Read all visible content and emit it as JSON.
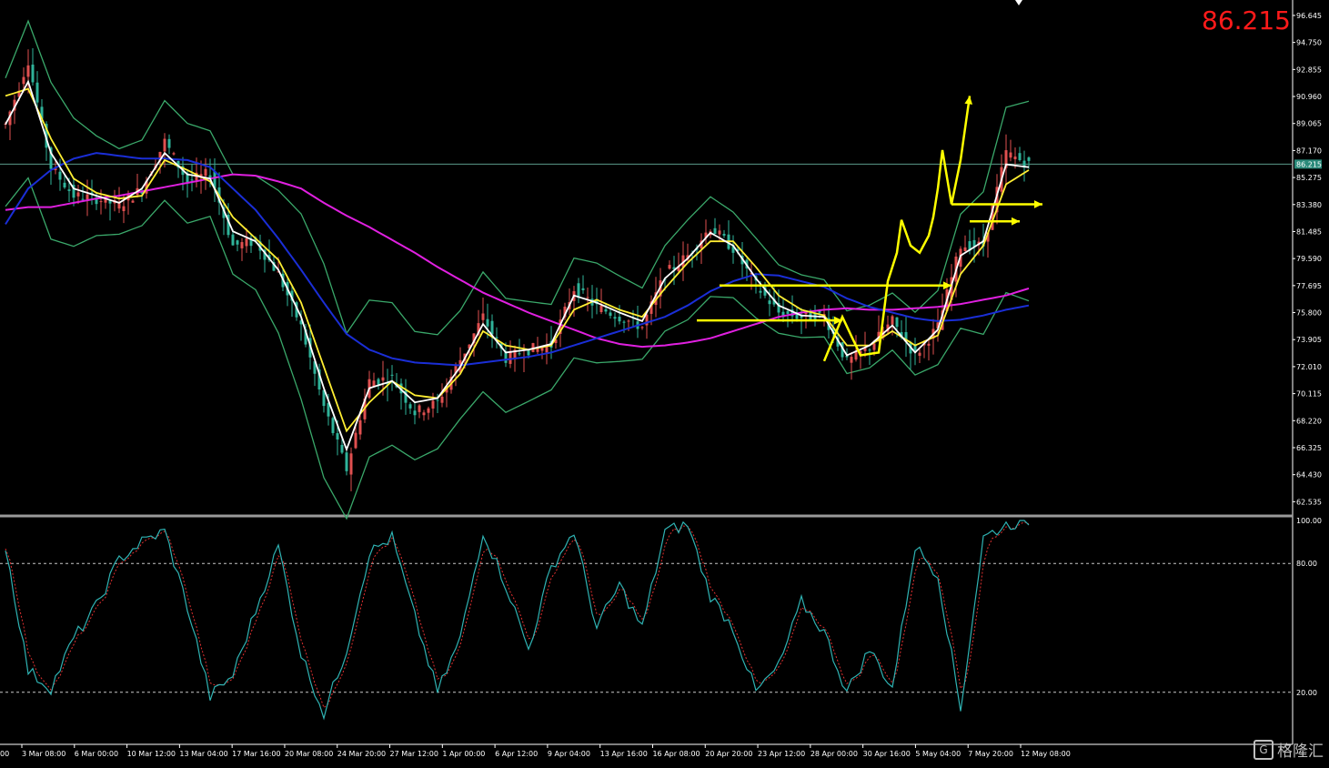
{
  "price_label": "86.215",
  "price_badge": "86.215",
  "watermark": {
    "text": "格隆汇",
    "logo": "G"
  },
  "colors": {
    "background": "#000000",
    "up_candle": "#e05050",
    "down_candle": "#2fb39a",
    "white_ma": "#ffffff",
    "yellow_ma": "#ffee33",
    "blue_ma": "#1a2ed6",
    "magenta_ma": "#e020e0",
    "bollinger": "#3aa86a",
    "annotation": "#ffff00",
    "stoch_main": "#2fb3b3",
    "stoch_signal": "#e03030",
    "price_text": "#ff1a1a",
    "axis_text": "#ffffff"
  },
  "chart_data": [
    {
      "type": "candlestick",
      "title": "",
      "ylim": [
        61.6,
        97.6
      ],
      "current_price": 86.215,
      "y_ticks": [
        "96.645",
        "94.750",
        "92.855",
        "90.960",
        "89.065",
        "87.170",
        "85.275",
        "83.380",
        "81.485",
        "79.590",
        "77.695",
        "75.800",
        "73.905",
        "72.010",
        "70.115",
        "68.220",
        "66.325",
        "64.430",
        "62.535"
      ],
      "x_ticks": [
        "3 Mar 08:00",
        "6 Mar 00:00",
        "10 Mar 12:00",
        "13 Mar 04:00",
        "17 Mar 16:00",
        "20 Mar 08:00",
        "24 Mar 20:00",
        "27 Mar 12:00",
        "1 Apr 00:00",
        "6 Apr 12:00",
        "9 Apr 04:00",
        "13 Apr 16:00",
        "16 Apr 08:00",
        "20 Apr 20:00",
        "23 Apr 12:00",
        "28 Apr 00:00",
        "30 Apr 16:00",
        "5 May 04:00",
        "7 May 20:00",
        "12 May 08:00"
      ],
      "x_edge_label": "00",
      "anchors": {
        "x": [
          0,
          5,
          10,
          15,
          20,
          25,
          30,
          35,
          40,
          45,
          50,
          55,
          60,
          65,
          70,
          75,
          80,
          85,
          90,
          95,
          100,
          105,
          110,
          115,
          120,
          125,
          130,
          135,
          140,
          145,
          150,
          155,
          160,
          165,
          170,
          175,
          180,
          185,
          190,
          195,
          200,
          205,
          210,
          215,
          220,
          225
        ],
        "close": [
          89.0,
          93.5,
          86.0,
          84.0,
          83.8,
          83.3,
          84.5,
          87.8,
          85.0,
          85.6,
          80.5,
          80.8,
          78.5,
          74.8,
          69.2,
          64.8,
          71.0,
          71.2,
          68.8,
          69.5,
          72.5,
          75.5,
          72.6,
          73.2,
          73.5,
          77.5,
          76.2,
          75.5,
          74.8,
          78.5,
          79.8,
          81.8,
          80.3,
          77.7,
          75.8,
          75.5,
          75.6,
          72.3,
          73.4,
          75.2,
          72.8,
          74.8,
          80.5,
          80.5,
          87.0,
          86.2
        ],
        "ma_white": [
          89.0,
          92.0,
          87.0,
          84.5,
          84.0,
          83.5,
          84.5,
          87.0,
          85.5,
          85.2,
          81.5,
          80.8,
          78.8,
          75.5,
          70.5,
          66.2,
          70.5,
          71.0,
          69.5,
          69.8,
          72.0,
          75.0,
          73.0,
          73.2,
          73.6,
          77.0,
          76.5,
          75.8,
          75.2,
          78.2,
          79.6,
          81.4,
          80.5,
          78.2,
          76.3,
          75.6,
          75.5,
          72.8,
          73.5,
          74.9,
          73.0,
          74.6,
          79.8,
          80.8,
          86.2,
          86.0
        ],
        "ma_yellow": [
          91.0,
          91.5,
          88.0,
          85.2,
          84.2,
          83.8,
          84.0,
          86.5,
          85.8,
          85.0,
          82.5,
          81.0,
          79.5,
          76.5,
          72.0,
          67.5,
          69.5,
          71.0,
          70.0,
          69.8,
          71.5,
          74.5,
          73.5,
          73.2,
          73.5,
          76.0,
          76.7,
          76.0,
          75.5,
          77.5,
          79.3,
          80.8,
          80.8,
          79.0,
          77.0,
          76.0,
          75.6,
          73.5,
          73.5,
          74.5,
          73.5,
          74.2,
          78.5,
          80.5,
          84.8,
          85.8
        ],
        "ma_blue": [
          82.0,
          84.5,
          85.8,
          86.6,
          87.0,
          86.8,
          86.6,
          86.6,
          86.5,
          86.0,
          84.5,
          83.0,
          81.0,
          78.8,
          76.5,
          74.3,
          73.2,
          72.6,
          72.3,
          72.2,
          72.1,
          72.3,
          72.5,
          72.7,
          73.0,
          73.5,
          74.0,
          74.5,
          75.0,
          75.5,
          76.3,
          77.3,
          78.0,
          78.5,
          78.4,
          78.0,
          77.6,
          76.8,
          76.2,
          75.8,
          75.4,
          75.2,
          75.3,
          75.6,
          76.0,
          76.3
        ],
        "ma_magenta": [
          83.0,
          83.2,
          83.2,
          83.5,
          83.8,
          84.0,
          84.3,
          84.6,
          84.9,
          85.2,
          85.5,
          85.4,
          85.0,
          84.5,
          83.5,
          82.6,
          81.8,
          80.9,
          80.0,
          79.0,
          78.1,
          77.2,
          76.5,
          75.8,
          75.2,
          74.6,
          74.0,
          73.6,
          73.4,
          73.5,
          73.7,
          74.0,
          74.5,
          75.0,
          75.5,
          75.8,
          76.0,
          76.1,
          76.0,
          76.0,
          76.1,
          76.2,
          76.4,
          76.7,
          77.0,
          77.5
        ],
        "bb_half_width": [
          4.5,
          5.5,
          5.5,
          4.5,
          3.5,
          3.0,
          3.0,
          3.5,
          3.5,
          3.0,
          3.5,
          4.0,
          5.0,
          6.5,
          7.5,
          6.5,
          5.5,
          5.0,
          4.5,
          4.0,
          3.8,
          4.2,
          4.0,
          3.5,
          3.0,
          3.5,
          3.5,
          3.0,
          2.5,
          3.0,
          3.5,
          3.5,
          3.0,
          2.8,
          2.4,
          2.2,
          2.0,
          2.2,
          2.2,
          2.0,
          2.2,
          2.6,
          4.0,
          5.0,
          6.5,
          7.0
        ]
      }
    },
    {
      "type": "line",
      "title": "",
      "ylim": [
        0,
        100
      ],
      "y_ticks": [
        "100.00",
        "80.00",
        "20.00"
      ],
      "levels": [
        80,
        20
      ],
      "series": [
        {
          "role": "main",
          "x": [
            0,
            5,
            10,
            15,
            20,
            25,
            30,
            35,
            40,
            45,
            50,
            55,
            60,
            65,
            70,
            75,
            80,
            85,
            90,
            95,
            100,
            105,
            110,
            115,
            120,
            125,
            130,
            135,
            140,
            145,
            150,
            155,
            160,
            165,
            170,
            175,
            180,
            185,
            190,
            195,
            200,
            205,
            210,
            215,
            220,
            225
          ],
          "values": [
            88,
            30,
            22,
            45,
            60,
            82,
            90,
            95,
            60,
            18,
            28,
            58,
            88,
            38,
            10,
            40,
            85,
            92,
            55,
            20,
            45,
            95,
            70,
            40,
            78,
            95,
            50,
            70,
            50,
            95,
            98,
            65,
            50,
            20,
            32,
            62,
            48,
            20,
            40,
            22,
            88,
            75,
            12,
            92,
            98,
            100
          ]
        }
      ]
    }
  ],
  "annotations": {
    "horizontal_arrows": [
      {
        "x0": 157,
        "x1": 208,
        "y": 77.7
      },
      {
        "x0": 152,
        "x1": 184,
        "y": 75.25
      },
      {
        "x0": 208,
        "x1": 228,
        "y": 83.4
      },
      {
        "x0": 212,
        "x1": 223,
        "y": 82.2
      }
    ],
    "zigzag_path": [
      [
        180,
        72.4
      ],
      [
        184,
        75.5
      ],
      [
        188,
        72.8
      ],
      [
        192,
        73.0
      ],
      [
        194,
        78.0
      ],
      [
        196,
        80.0
      ],
      [
        197,
        82.3
      ],
      [
        199,
        80.5
      ],
      [
        201,
        80.0
      ],
      [
        203,
        81.2
      ],
      [
        204,
        82.5
      ],
      [
        205,
        84.5
      ],
      [
        206,
        87.2
      ],
      [
        208,
        83.4
      ],
      [
        210,
        86.5
      ],
      [
        212,
        91.0
      ]
    ]
  }
}
